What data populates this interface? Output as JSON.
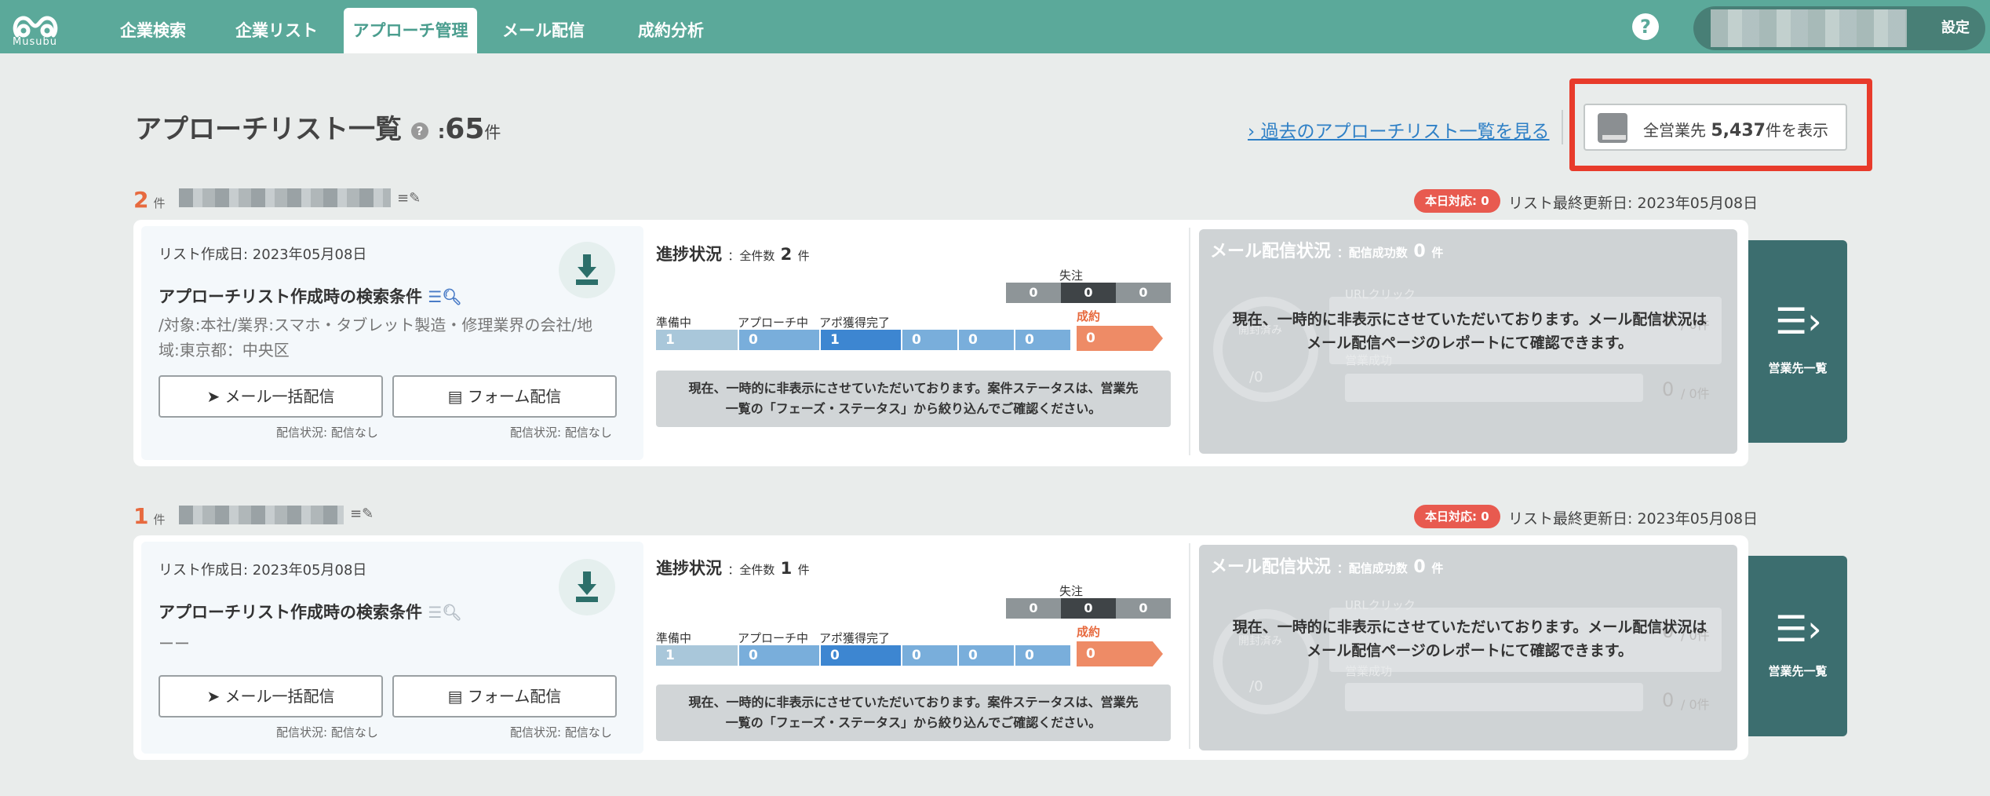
{
  "nav": {
    "logo_text": "Musubu",
    "tabs": [
      "企業検索",
      "企業リスト",
      "アプローチ管理",
      "メール配信",
      "成約分析"
    ],
    "active_tab": "アプローチ管理",
    "help_icon": "?",
    "settings_label": "設定"
  },
  "header": {
    "title": "アプローチリスト一覧",
    "count_prefix": ":",
    "count": "65",
    "count_unit": "件",
    "past_link": "過去のアプローチリスト一覧を見る",
    "show_all_prefix": "全営業先",
    "show_all_count": "5,437",
    "show_all_suffix": "件を表示"
  },
  "lists": [
    {
      "count": "2",
      "unit": "件",
      "today_badge": "本日対応: 0",
      "last_updated": "リスト最終更新日: 2023年05月08日",
      "created": "リスト作成日: 2023年05月08日",
      "cond_title": "アプローチリスト作成時の検索条件",
      "cond_text": "/対象:本社/業界:スマホ・タブレット製造・修理業界の会社/地域:東京都：中央区",
      "mail_btn": "メール一括配信",
      "form_btn": "フォーム配信",
      "mail_status": "配信状況: 配信なし",
      "form_status": "配信状況: 配信なし",
      "progress_title": "進捗状況",
      "progress_total_label": "：全件数",
      "progress_total": "2",
      "progress_unit": "件",
      "lost_label": "失注",
      "lost_values": [
        "0",
        "0",
        "0"
      ],
      "won_label": "成約",
      "stage_labels": [
        "準備中",
        "アプローチ中",
        "アポ獲得完了"
      ],
      "stage_values": [
        "1",
        "0",
        "1",
        "0",
        "0",
        "0"
      ],
      "won_value": "0",
      "progress_note": "現在、一時的に非表示にさせていただいております。案件ステータスは、営業先一覧の「フェーズ・ステータス」から絞り込んでご確認ください。",
      "mail_title": "メール配信状況",
      "mail_sub": "：配信成功数",
      "mail_count": "0",
      "mail_unit": "件",
      "opened_label": "開封済み",
      "opened_value": "/0",
      "url_click_label": "URLクリック",
      "url_value": "0",
      "url_unit": "/ 0件",
      "biz_label": "営業成功",
      "biz_value": "0",
      "biz_unit": "/ 0件",
      "mail_note": "現在、一時的に非表示にさせていただいております。メール配信状況はメール配信ページのレポートにて確認できます。",
      "side_label": "営業先一覧"
    },
    {
      "count": "1",
      "unit": "件",
      "today_badge": "本日対応: 0",
      "last_updated": "リスト最終更新日: 2023年05月08日",
      "created": "リスト作成日: 2023年05月08日",
      "cond_title": "アプローチリスト作成時の検索条件",
      "cond_text": "ーー",
      "mail_btn": "メール一括配信",
      "form_btn": "フォーム配信",
      "mail_status": "配信状況: 配信なし",
      "form_status": "配信状況: 配信なし",
      "progress_title": "進捗状況",
      "progress_total_label": "：全件数",
      "progress_total": "1",
      "progress_unit": "件",
      "lost_label": "失注",
      "lost_values": [
        "0",
        "0",
        "0"
      ],
      "won_label": "成約",
      "stage_labels": [
        "準備中",
        "アプローチ中",
        "アポ獲得完了"
      ],
      "stage_values": [
        "1",
        "0",
        "0",
        "0",
        "0",
        "0"
      ],
      "won_value": "0",
      "progress_note": "現在、一時的に非表示にさせていただいております。案件ステータスは、営業先一覧の「フェーズ・ステータス」から絞り込んでご確認ください。",
      "mail_title": "メール配信状況",
      "mail_sub": "：配信成功数",
      "mail_count": "0",
      "mail_unit": "件",
      "opened_label": "開封済み",
      "opened_value": "/0",
      "url_click_label": "URLクリック",
      "url_value": "0",
      "url_unit": "/ 0件",
      "biz_label": "営業成功",
      "biz_value": "0",
      "biz_unit": "/ 0件",
      "mail_note": "現在、一時的に非表示にさせていただいております。メール配信状況はメール配信ページのレポートにて確認できます。",
      "side_label": "営業先一覧"
    }
  ],
  "colors": {
    "nav": "#5ba99a",
    "accent": "#e76a3f",
    "highlight": "#e83b2b",
    "side": "#3c6e6f"
  }
}
